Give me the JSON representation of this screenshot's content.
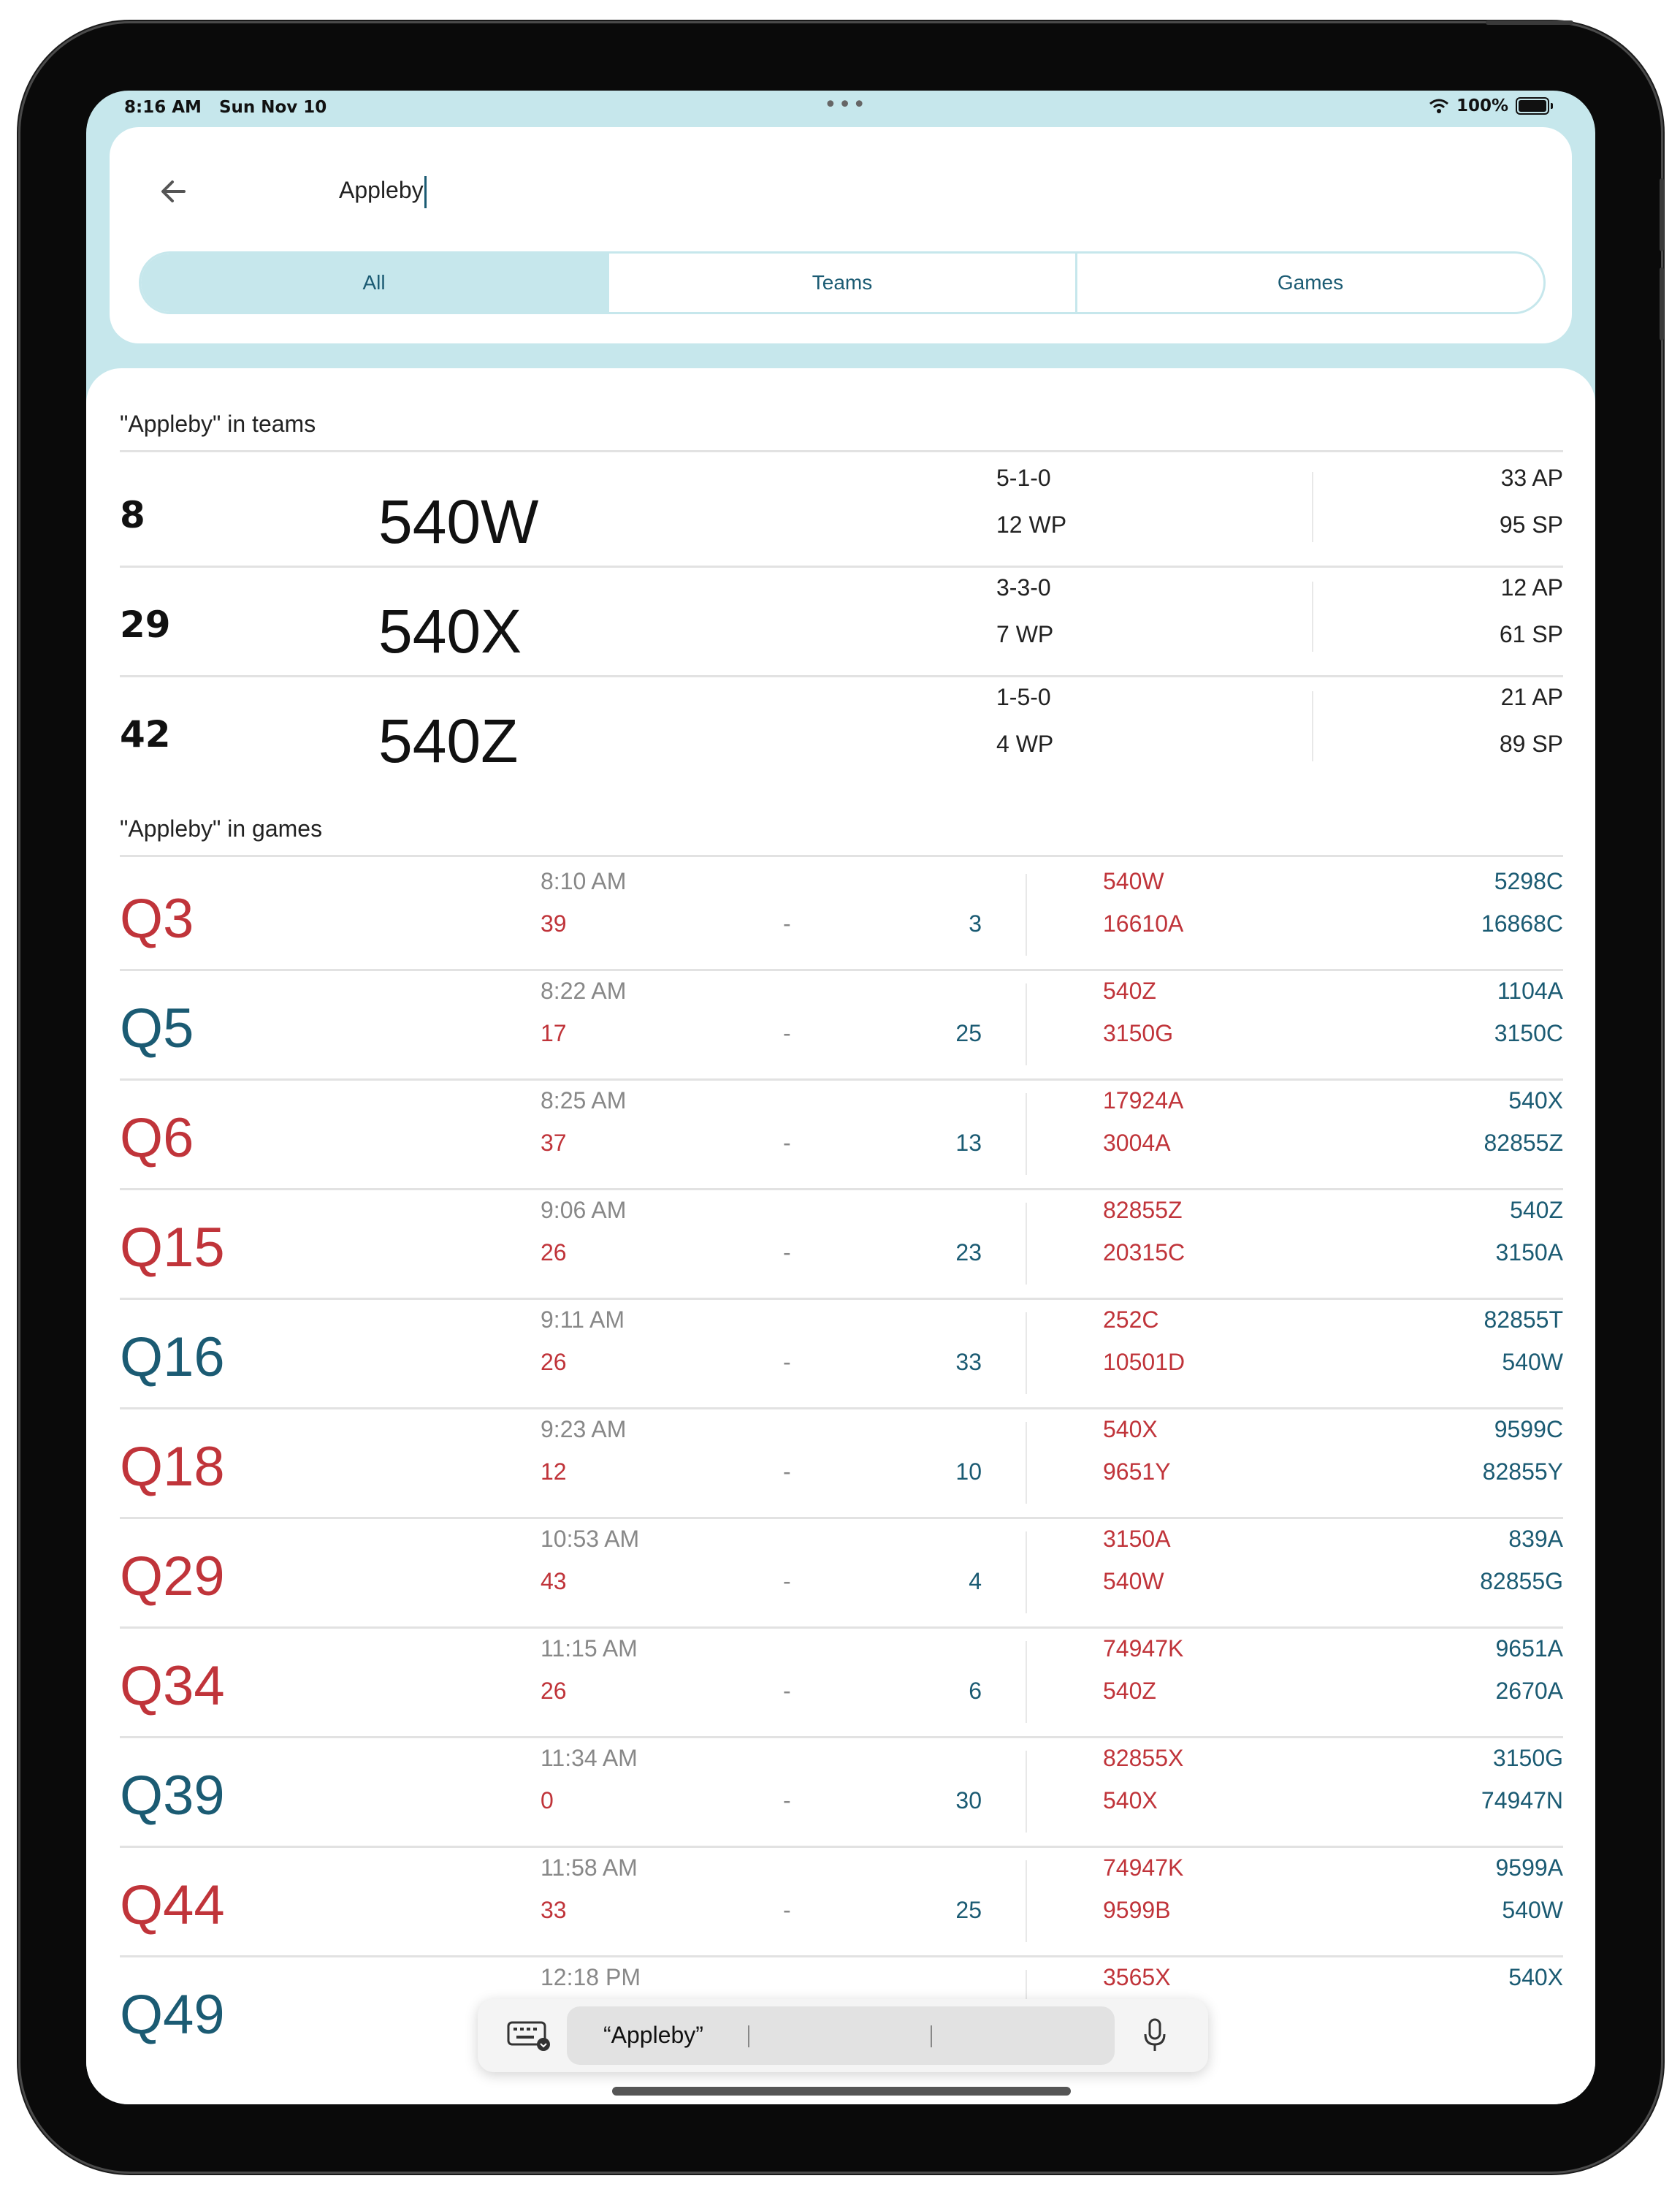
{
  "status": {
    "time": "8:16 AM",
    "date": "Sun Nov 10",
    "battery": "100%"
  },
  "search": {
    "query": "Appleby"
  },
  "tabs": [
    "All",
    "Teams",
    "Games"
  ],
  "teams_section": {
    "title": "\"Appleby\" in teams",
    "rows": [
      {
        "rank": "8",
        "team": "540W",
        "record": "5-1-0",
        "wp": "12 WP",
        "ap": "33 AP",
        "sp": "95 SP"
      },
      {
        "rank": "29",
        "team": "540X",
        "record": "3-3-0",
        "wp": "7 WP",
        "ap": "12 AP",
        "sp": "61 SP"
      },
      {
        "rank": "42",
        "team": "540Z",
        "record": "1-5-0",
        "wp": "4 WP",
        "ap": "21 AP",
        "sp": "89 SP"
      }
    ]
  },
  "games_section": {
    "title": "\"Appleby\" in games",
    "rows": [
      {
        "name": "Q3",
        "name_color": "red",
        "time": "8:10 AM",
        "red_score": "39",
        "dash": "-",
        "blue_score": "3",
        "red1": "540W",
        "red2": "16610A",
        "blue1": "5298C",
        "blue2": "16868C"
      },
      {
        "name": "Q5",
        "name_color": "blue",
        "time": "8:22 AM",
        "red_score": "17",
        "dash": "-",
        "blue_score": "25",
        "red1": "540Z",
        "red2": "3150G",
        "blue1": "1104A",
        "blue2": "3150C"
      },
      {
        "name": "Q6",
        "name_color": "red",
        "time": "8:25 AM",
        "red_score": "37",
        "dash": "-",
        "blue_score": "13",
        "red1": "17924A",
        "red2": "3004A",
        "blue1": "540X",
        "blue2": "82855Z"
      },
      {
        "name": "Q15",
        "name_color": "red",
        "time": "9:06 AM",
        "red_score": "26",
        "dash": "-",
        "blue_score": "23",
        "red1": "82855Z",
        "red2": "20315C",
        "blue1": "540Z",
        "blue2": "3150A"
      },
      {
        "name": "Q16",
        "name_color": "blue",
        "time": "9:11 AM",
        "red_score": "26",
        "dash": "-",
        "blue_score": "33",
        "red1": "252C",
        "red2": "10501D",
        "blue1": "82855T",
        "blue2": "540W"
      },
      {
        "name": "Q18",
        "name_color": "red",
        "time": "9:23 AM",
        "red_score": "12",
        "dash": "-",
        "blue_score": "10",
        "red1": "540X",
        "red2": "9651Y",
        "blue1": "9599C",
        "blue2": "82855Y"
      },
      {
        "name": "Q29",
        "name_color": "red",
        "time": "10:53 AM",
        "red_score": "43",
        "dash": "-",
        "blue_score": "4",
        "red1": "3150A",
        "red2": "540W",
        "blue1": "839A",
        "blue2": "82855G"
      },
      {
        "name": "Q34",
        "name_color": "red",
        "time": "11:15 AM",
        "red_score": "26",
        "dash": "-",
        "blue_score": "6",
        "red1": "74947K",
        "red2": "540Z",
        "blue1": "9651A",
        "blue2": "2670A"
      },
      {
        "name": "Q39",
        "name_color": "blue",
        "time": "11:34 AM",
        "red_score": "0",
        "dash": "-",
        "blue_score": "30",
        "red1": "82855X",
        "red2": "540X",
        "blue1": "3150G",
        "blue2": "74947N"
      },
      {
        "name": "Q44",
        "name_color": "red",
        "time": "11:58 AM",
        "red_score": "33",
        "dash": "-",
        "blue_score": "25",
        "red1": "74947K",
        "red2": "9599B",
        "blue1": "9599A",
        "blue2": "540W"
      },
      {
        "name": "Q49",
        "name_color": "blue",
        "time": "12:18 PM",
        "red_score": "",
        "dash": "",
        "blue_score": "",
        "red1": "3565X",
        "red2": "",
        "blue1": "540X",
        "blue2": ""
      }
    ]
  },
  "keyboard_bar": {
    "suggestion": "“Appleby”"
  },
  "colors": {
    "accent_light": "#c6e7ec",
    "red": "#c0343a",
    "blue": "#1b5b73"
  }
}
